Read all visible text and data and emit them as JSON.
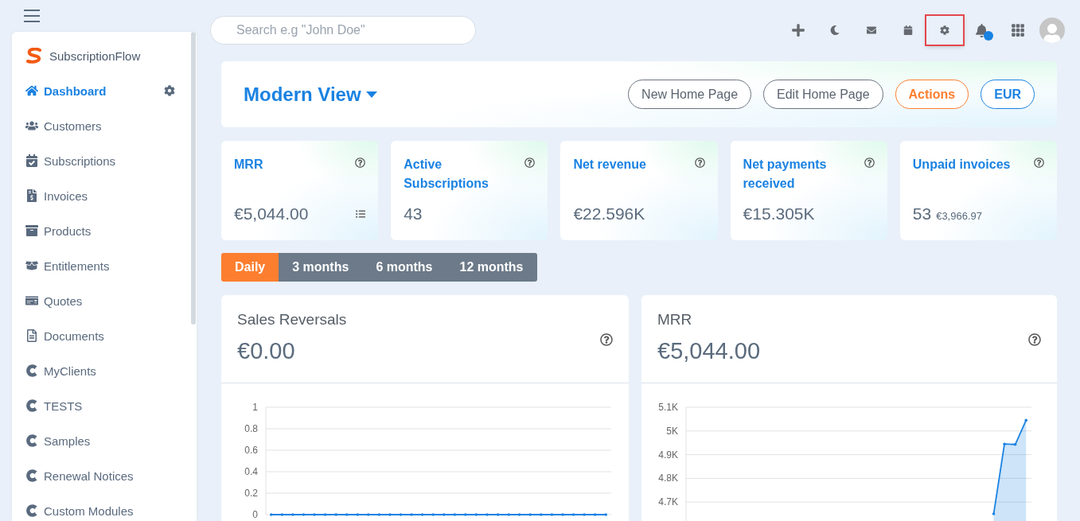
{
  "brand": {
    "name": "SubscriptionFlow"
  },
  "sidebar": {
    "items": [
      {
        "label": "Dashboard",
        "selected": true
      },
      {
        "label": "Customers",
        "selected": false
      },
      {
        "label": "Subscriptions",
        "selected": false
      },
      {
        "label": "Invoices",
        "selected": false
      },
      {
        "label": "Products",
        "selected": false
      },
      {
        "label": "Entitlements",
        "selected": false
      },
      {
        "label": "Quotes",
        "selected": false
      },
      {
        "label": "Documents",
        "selected": false
      },
      {
        "label": "MyClients",
        "selected": false
      },
      {
        "label": "TESTS",
        "selected": false
      },
      {
        "label": "Samples",
        "selected": false
      },
      {
        "label": "Renewal Notices",
        "selected": false
      },
      {
        "label": "Custom Modules",
        "selected": false
      }
    ]
  },
  "search": {
    "placeholder": "Search e.g \"John Doe\""
  },
  "toolbar_icons": [
    {
      "kind": "add",
      "highlighted": false,
      "badge": false
    },
    {
      "kind": "moon",
      "highlighted": false,
      "badge": false
    },
    {
      "kind": "mail",
      "highlighted": false,
      "badge": false
    },
    {
      "kind": "calendar",
      "highlighted": false,
      "badge": false
    },
    {
      "kind": "settings",
      "highlighted": true,
      "badge": false
    },
    {
      "kind": "bell",
      "highlighted": false,
      "badge": true
    },
    {
      "kind": "apps",
      "highlighted": false,
      "badge": false
    }
  ],
  "header": {
    "title": "Modern View",
    "buttons": [
      {
        "label": "New Home Page",
        "kind": "default"
      },
      {
        "label": "Edit Home Page",
        "kind": "default"
      },
      {
        "label": "Actions",
        "kind": "accent"
      },
      {
        "label": "EUR",
        "kind": "primary"
      }
    ]
  },
  "kpis": [
    {
      "title": "MRR",
      "value": "€5,044.00",
      "details_icon": true
    },
    {
      "title": "Active Subscriptions",
      "value": "43",
      "details_icon": false
    },
    {
      "title": "Net revenue",
      "value": "€22.596K",
      "details_icon": false
    },
    {
      "title": "Net payments received",
      "value": "€15.305K",
      "details_icon": false
    },
    {
      "title": "Unpaid invoices",
      "value": "53",
      "sub": "€3,966.97",
      "details_icon": false
    }
  ],
  "periods": [
    {
      "label": "Daily",
      "selected": true
    },
    {
      "label": "3 months",
      "selected": false
    },
    {
      "label": "6 months",
      "selected": false
    },
    {
      "label": "12 months",
      "selected": false
    }
  ],
  "charts": [
    {
      "title": "Sales Reversals",
      "value": "€0.00",
      "chart_data": {
        "type": "line",
        "grid": true,
        "ylim": [
          0,
          1
        ],
        "yticks": [
          0,
          0.2,
          0.4,
          0.6,
          0.8,
          1
        ],
        "series": [
          {
            "color": "#1a82e2",
            "values": [
              0,
              0,
              0,
              0,
              0,
              0,
              0,
              0,
              0,
              0,
              0,
              0,
              0,
              0,
              0,
              0,
              0,
              0,
              0,
              0,
              0,
              0,
              0,
              0,
              0,
              0,
              0,
              0,
              0,
              0,
              0,
              0
            ]
          }
        ]
      }
    },
    {
      "title": "MRR",
      "value": "€5,044.00",
      "chart_data": {
        "type": "area",
        "grid": true,
        "ylim": [
          4620,
          5100
        ],
        "yticks": [
          {
            "value": 4700,
            "label": "4.7K"
          },
          {
            "value": 4800,
            "label": "4.8K"
          },
          {
            "value": 4900,
            "label": "4.9K"
          },
          {
            "value": 5000,
            "label": "5K"
          },
          {
            "value": 5100,
            "label": "5.1K"
          }
        ],
        "series": [
          {
            "color": "#1a82e2",
            "values": [
              null,
              null,
              null,
              null,
              null,
              null,
              null,
              null,
              null,
              null,
              null,
              null,
              null,
              null,
              null,
              null,
              null,
              null,
              null,
              null,
              null,
              null,
              null,
              null,
              null,
              null,
              null,
              null,
              4650,
              4945,
              4943,
              5045
            ]
          }
        ]
      }
    }
  ]
}
